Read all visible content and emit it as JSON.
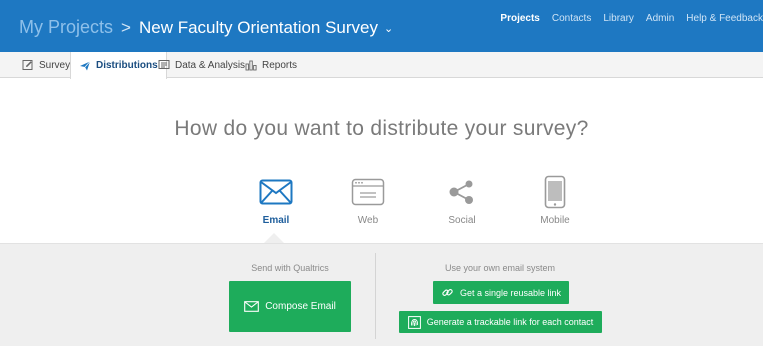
{
  "header": {
    "breadcrumb_root": "My Projects",
    "separator": ">",
    "project_name": "New Faculty Orientation Survey",
    "chevron": "⌄",
    "nav": [
      "Projects",
      "Contacts",
      "Library",
      "Admin",
      "Help & Feedback"
    ]
  },
  "tabs": [
    {
      "label": "Survey",
      "icon": "edit-icon"
    },
    {
      "label": "Distributions",
      "icon": "paper-plane-icon"
    },
    {
      "label": "Data & Analysis",
      "icon": "data-icon"
    },
    {
      "label": "Reports",
      "icon": "bar-chart-icon"
    }
  ],
  "headline": "How do you want to distribute your survey?",
  "channels": [
    {
      "label": "Email",
      "icon": "envelope-icon"
    },
    {
      "label": "Web",
      "icon": "browser-window-icon"
    },
    {
      "label": "Social",
      "icon": "share-icon"
    },
    {
      "label": "Mobile",
      "icon": "phone-icon"
    }
  ],
  "email_panel": {
    "qualtrics_label": "Send with Qualtrics",
    "compose_button": "Compose Email",
    "own_system_label": "Use your own email system",
    "reusable_link_button": "Get a single reusable link",
    "trackable_link_button": "Generate a trackable link for each contact"
  },
  "colors": {
    "header_blue": "#1e78c2",
    "accent_green": "#1eac5b",
    "active_tab_text": "#1a4d80",
    "panel_gray": "#efefef"
  }
}
